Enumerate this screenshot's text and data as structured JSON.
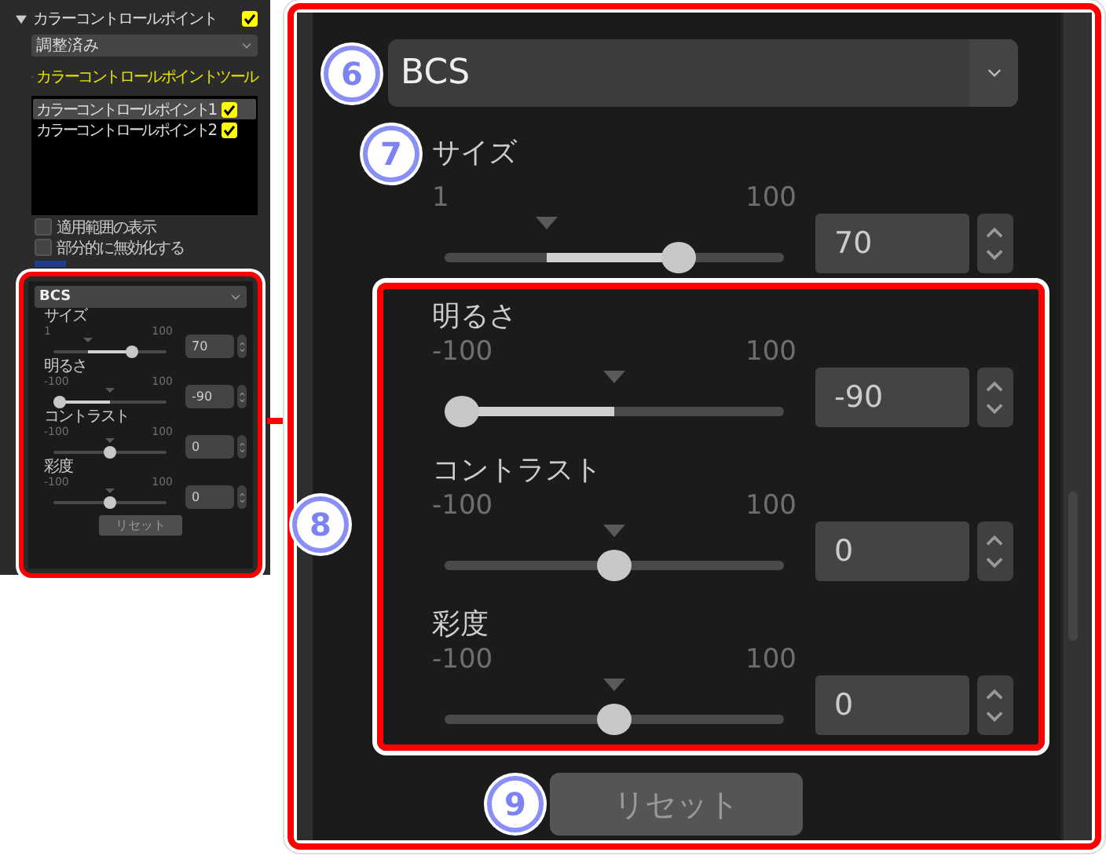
{
  "overview_panel": {
    "section": {
      "title": "カラーコントロールポイント",
      "expanded": true,
      "checked": true
    },
    "status_dropdown": "調整済み",
    "tool_label": "カラーコントロールポイントツール",
    "points": [
      {
        "label": "カラーコントロールポイント1",
        "checked": true,
        "selected": true
      },
      {
        "label": "カラーコントロールポイント2",
        "checked": true,
        "selected": false
      }
    ],
    "options": [
      {
        "label": "適用範囲の表示",
        "checked": false
      },
      {
        "label": "部分的に無効化する",
        "checked": false
      }
    ],
    "bcs": {
      "mode": "BCS",
      "sliders": [
        {
          "kind": "size",
          "label": "サイズ",
          "min": "1",
          "max": "100",
          "value": "70",
          "level": 0.69
        },
        {
          "kind": "signed",
          "label": "明るさ",
          "min": "-100",
          "max": "100",
          "value": "-90",
          "level": 0.05
        },
        {
          "kind": "signed",
          "label": "コントラスト",
          "min": "-100",
          "max": "100",
          "value": "0",
          "level": 0.5
        },
        {
          "kind": "signed",
          "label": "彩度",
          "min": "-100",
          "max": "100",
          "value": "0",
          "level": 0.5
        }
      ],
      "reset": "リセット"
    }
  },
  "detail_panel": {
    "mode": {
      "value": "BCS",
      "callout": "6"
    },
    "size_slider": {
      "kind": "size",
      "label": "サイズ",
      "min": "1",
      "max": "100",
      "value": "70",
      "level": 0.69,
      "callout": "7"
    },
    "group": {
      "callout": "8",
      "sliders": [
        {
          "kind": "signed",
          "label": "明るさ",
          "min": "-100",
          "max": "100",
          "value": "-90",
          "level": 0.05
        },
        {
          "kind": "signed",
          "label": "コントラスト",
          "min": "-100",
          "max": "100",
          "value": "0",
          "level": 0.5
        },
        {
          "kind": "signed",
          "label": "彩度",
          "min": "-100",
          "max": "100",
          "value": "0",
          "level": 0.5
        }
      ]
    },
    "reset": {
      "label": "リセット",
      "callout": "9"
    }
  }
}
